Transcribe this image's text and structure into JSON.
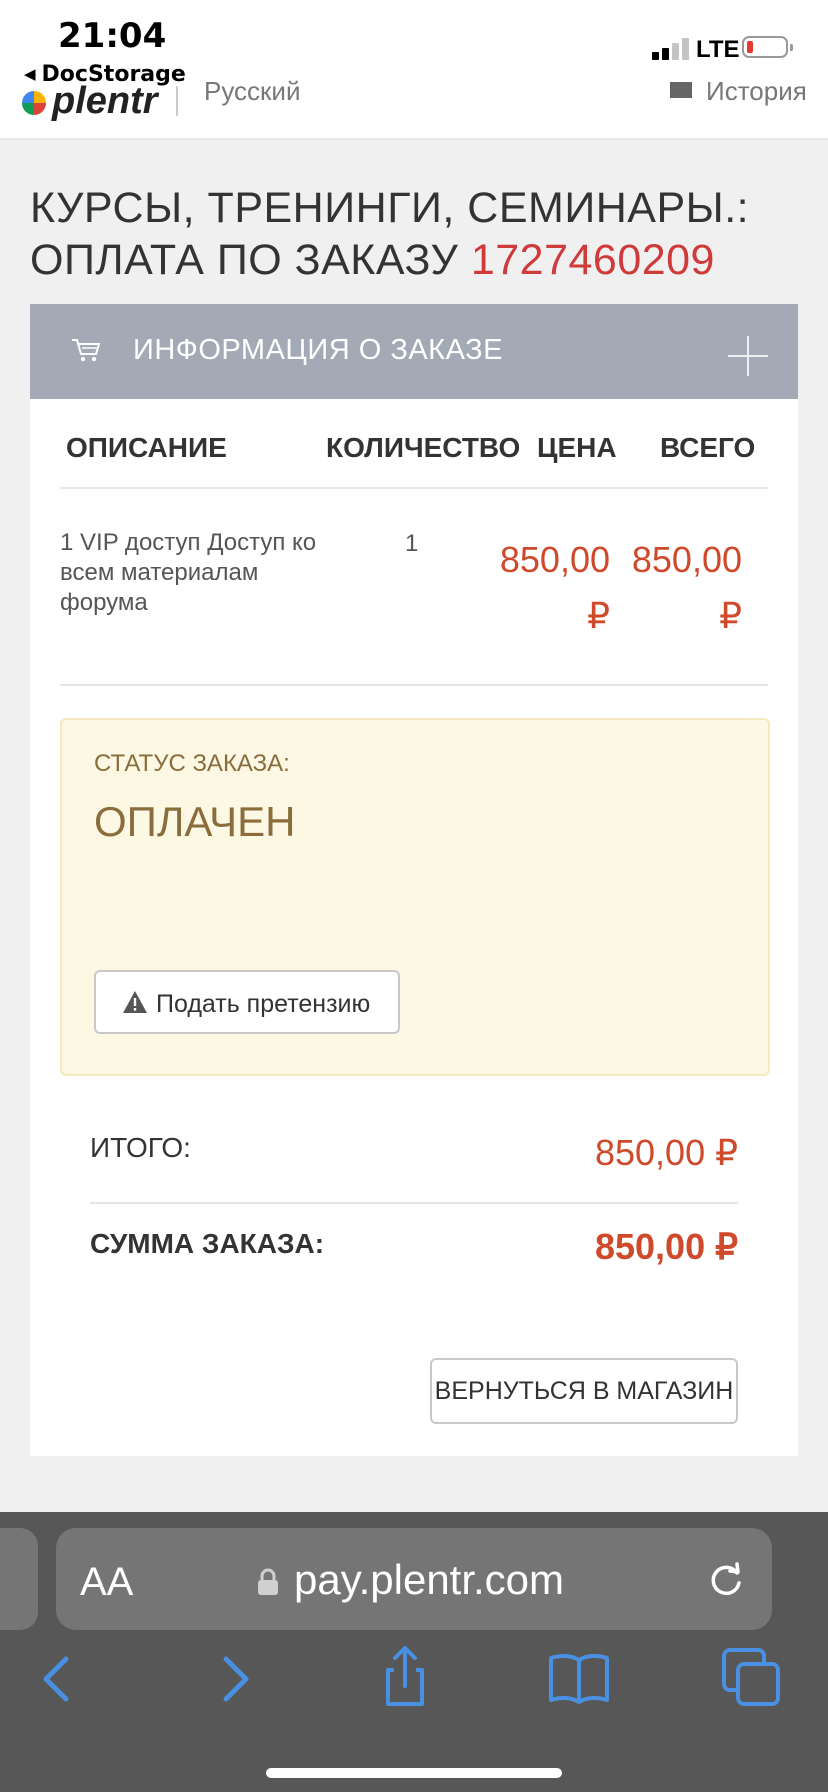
{
  "status_bar": {
    "time": "21:04",
    "back_app": "DocStorage",
    "network": "LTE"
  },
  "site_header": {
    "logo": "plentr",
    "language": "Русский",
    "history": "История"
  },
  "page": {
    "title_line1": "КУРСЫ, ТРЕНИНГИ, СЕМИНАРЫ.:",
    "title_line2": "ОПЛАТА ПО ЗАКАЗУ",
    "order_number": "1727460209"
  },
  "order": {
    "section_title": "ИНФОРМАЦИЯ О ЗАКАЗЕ",
    "columns": [
      "ОПИСАНИЕ",
      "КОЛИЧЕСТВО",
      "ЦЕНА",
      "ВСЕГО"
    ],
    "items": [
      {
        "description": "1 VIP доступ Доступ ко всем материалам форума",
        "qty": "1",
        "price": "850,00",
        "total": "850,00",
        "currency": "₽"
      }
    ],
    "status_label": "СТАТУС ЗАКАЗА:",
    "status_value": "ОПЛАЧЕН",
    "claim_button": "Подать претензию",
    "subtotal_label": "ИТОГО:",
    "subtotal_value": "850,00 ₽",
    "total_label": "СУММА ЗАКАЗА:",
    "total_value": "850,00 ₽",
    "back_button": "ВЕРНУТЬСЯ В МАГАЗИН"
  },
  "browser": {
    "aa_label": "AA",
    "url": "pay.plentr.com"
  },
  "colors": {
    "accent_price": "#cf4a2a",
    "order_number": "#cf3a3a",
    "header_bar": "#a3aab5",
    "status_bg": "#fcf8e3",
    "status_text": "#8a6d3b",
    "ios_blue": "#4a90e2"
  }
}
